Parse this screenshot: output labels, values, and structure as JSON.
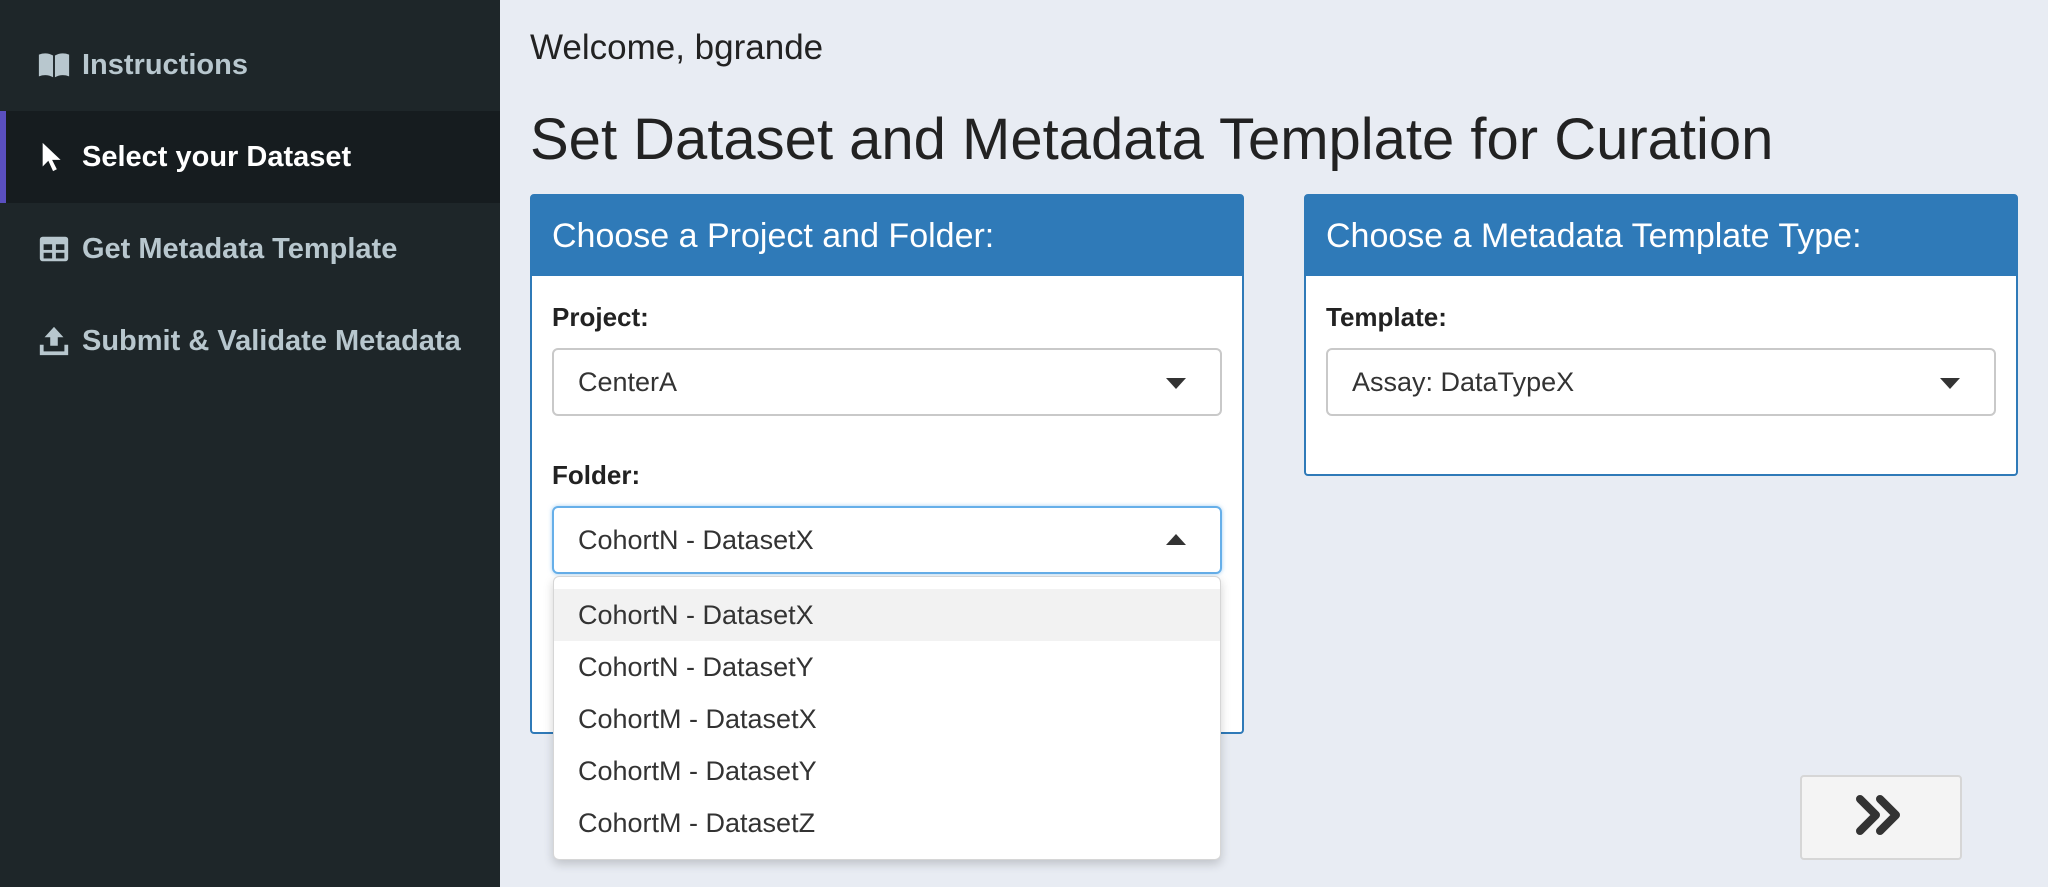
{
  "sidebar": {
    "items": [
      {
        "label": "Instructions",
        "icon": "book-icon",
        "active": false
      },
      {
        "label": "Select your Dataset",
        "icon": "pointer-icon",
        "active": true
      },
      {
        "label": "Get Metadata Template",
        "icon": "table-icon",
        "active": false
      },
      {
        "label": "Submit & Validate Metadata",
        "icon": "upload-icon",
        "active": false
      }
    ]
  },
  "header": {
    "welcome": "Welcome, bgrande",
    "title": "Set Dataset and Metadata Template for Curation"
  },
  "project_box": {
    "title": "Choose a Project and Folder:",
    "project_label": "Project:",
    "project_value": "CenterA",
    "folder_label": "Folder:",
    "folder_value": "CohortN - DatasetX",
    "folder_options": [
      "CohortN - DatasetX",
      "CohortN - DatasetY",
      "CohortM - DatasetX",
      "CohortM - DatasetY",
      "CohortM - DatasetZ"
    ]
  },
  "template_box": {
    "title": "Choose a Metadata Template Type:",
    "template_label": "Template:",
    "template_value": "Assay: DataTypeX"
  },
  "next_button": {
    "icon": "double-chevron-right-icon"
  },
  "colors": {
    "sidebar_bg": "#1e2629",
    "accent": "#2f7ab8",
    "active_bar": "#5a4fc0"
  }
}
